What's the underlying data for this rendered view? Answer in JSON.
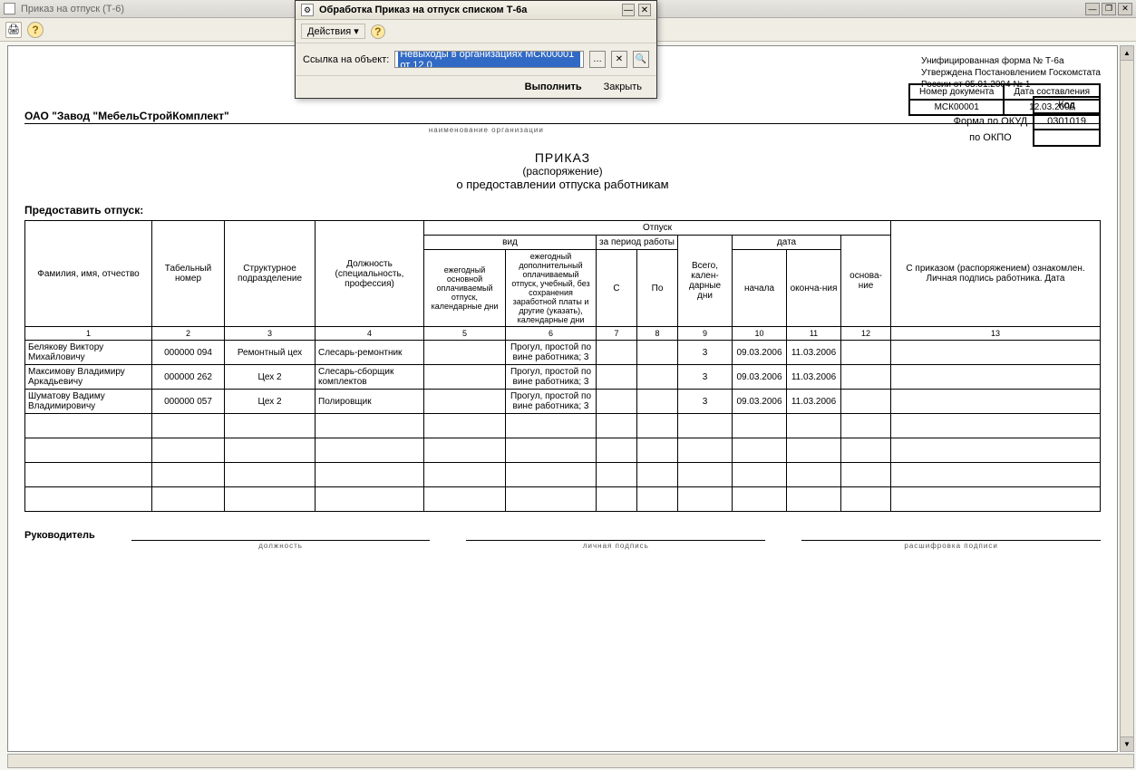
{
  "window": {
    "title": "Приказ на отпуск (Т-6)"
  },
  "dialog": {
    "title": "Обработка  Приказ на отпуск списком Т-6а",
    "actions_label": "Действия",
    "link_label": "Ссылка на объект:",
    "link_value": "Невыходы в организациях МСК00001 от 12.0",
    "btn_run": "Выполнить",
    "btn_close": "Закрыть"
  },
  "form_info": {
    "line1": "Унифицированная форма № Т-6а",
    "line2": "Утверждена Постановлением Госкомстата",
    "line3": "России от 05.01.2004 № 1"
  },
  "codes": {
    "header": "Код",
    "okud_label": "Форма по ОКУД",
    "okud_value": "0301019",
    "okpo_label": "по ОКПО",
    "okpo_value": ""
  },
  "org": {
    "name": "ОАО \"Завод \"МебельСтройКомплект\"",
    "caption": "наименование организации"
  },
  "doc_title": {
    "l1": "ПРИКАЗ",
    "l2": "(распоряжение)",
    "l3": "о предоставлении отпуска работникам"
  },
  "docnum": {
    "h1": "Номер документа",
    "h2": "Дата составления",
    "num": "МСК00001",
    "date": "12.03.2006"
  },
  "grant_label": "Предоставить отпуск:",
  "columns": {
    "c1": "Фамилия, имя, отчество",
    "c2": "Табельный номер",
    "c3": "Структурное подразделение",
    "c4": "Должность (специальность, профессия)",
    "vac_group": "Отпуск",
    "type_group": "вид",
    "c5": "ежегодный основной оплачиваемый отпуск, календарные дни",
    "c6": "ежегодный дополнительный оплачиваемый отпуск, учебный, без сохранения заработной платы и другие (указать), календарные дни",
    "period_group": "за период работы",
    "c7": "С",
    "c8": "По",
    "c9": "Всего, кален-дарные дни",
    "date_group": "дата",
    "c10": "начала",
    "c11": "оконча-ния",
    "c12": "основа-ние",
    "c13": "С приказом (распоряжением) ознакомлен. Личная подпись работника. Дата"
  },
  "colnums": {
    "n1": "1",
    "n2": "2",
    "n3": "3",
    "n4": "4",
    "n5": "5",
    "n6": "6",
    "n7": "7",
    "n8": "8",
    "n9": "9",
    "n10": "10",
    "n11": "11",
    "n12": "12",
    "n13": "13"
  },
  "rows": [
    {
      "fio": "Белякову Виктору Михайловичу",
      "tab": "000000 094",
      "dept": "Ремонтный цех",
      "pos": "Слесарь-ремонтник",
      "c5": "",
      "c6": "Прогул, простой по вине работника; 3",
      "c7": "",
      "c8": "",
      "total": "3",
      "start": "09.03.2006",
      "end": "11.03.2006",
      "basis": "",
      "sign": ""
    },
    {
      "fio": "Максимову Владимиру Аркадьевичу",
      "tab": "000000 262",
      "dept": "Цех 2",
      "pos": "Слесарь-сборщик комплектов",
      "c5": "",
      "c6": "Прогул, простой по вине работника; 3",
      "c7": "",
      "c8": "",
      "total": "3",
      "start": "09.03.2006",
      "end": "11.03.2006",
      "basis": "",
      "sign": ""
    },
    {
      "fio": "Шуматову Вадиму Владимировичу",
      "tab": "000000 057",
      "dept": "Цех 2",
      "pos": "Полировщик",
      "c5": "",
      "c6": "Прогул, простой по вине работника; 3",
      "c7": "",
      "c8": "",
      "total": "3",
      "start": "09.03.2006",
      "end": "11.03.2006",
      "basis": "",
      "sign": ""
    }
  ],
  "signature": {
    "label": "Руководитель",
    "cap1": "должность",
    "cap2": "личная  подпись",
    "cap3": "расшифровка  подписи"
  }
}
